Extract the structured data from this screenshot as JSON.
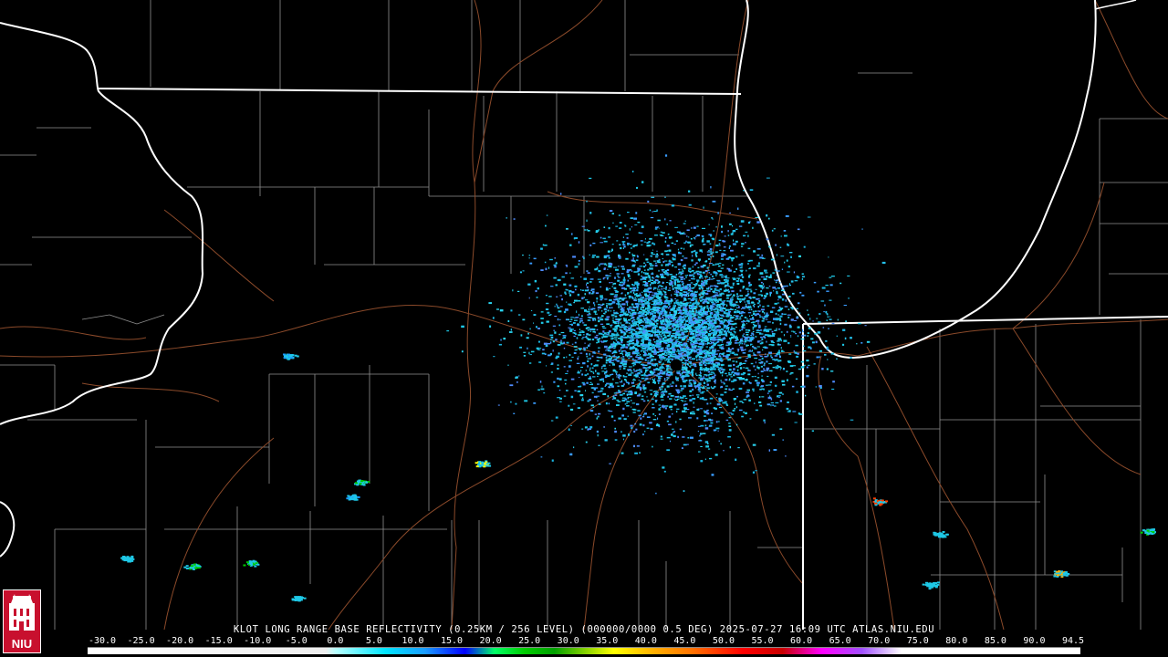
{
  "caption": "KLOT LONG RANGE BASE REFLECTIVITY (0.25KM / 256 LEVEL) (000000/0000 0.5 DEG) 2025-07-27 16:09 UTC  ATLAS.NIU.EDU",
  "scale": {
    "labels": [
      "-30.0",
      "-25.0",
      "-20.0",
      "-15.0",
      "-10.0",
      "-5.0",
      "0.0",
      "5.0",
      "10.0",
      "15.0",
      "20.0",
      "25.0",
      "30.0",
      "35.0",
      "40.0",
      "45.0",
      "50.0",
      "55.0",
      "60.0",
      "65.0",
      "70.0",
      "75.0",
      "80.0",
      "85.0",
      "90.0",
      "94.5"
    ],
    "colors": {
      "light_cyan": "#00e5ff",
      "blue": "#1a9cff",
      "green": "#00cc00",
      "yellow": "#ffff00",
      "red": "#ff0000",
      "magenta": "#ff00ff"
    }
  },
  "logo": {
    "text": "NIU",
    "icon": "university-tower-icon",
    "color": "#c8102e"
  },
  "radar_site": {
    "icon": "radar-site-dot-icon"
  },
  "map_colors": {
    "background": "#000000",
    "state_border": "#ffffff",
    "county_border": "#9a9a9a",
    "road": "#8b4a2a"
  }
}
